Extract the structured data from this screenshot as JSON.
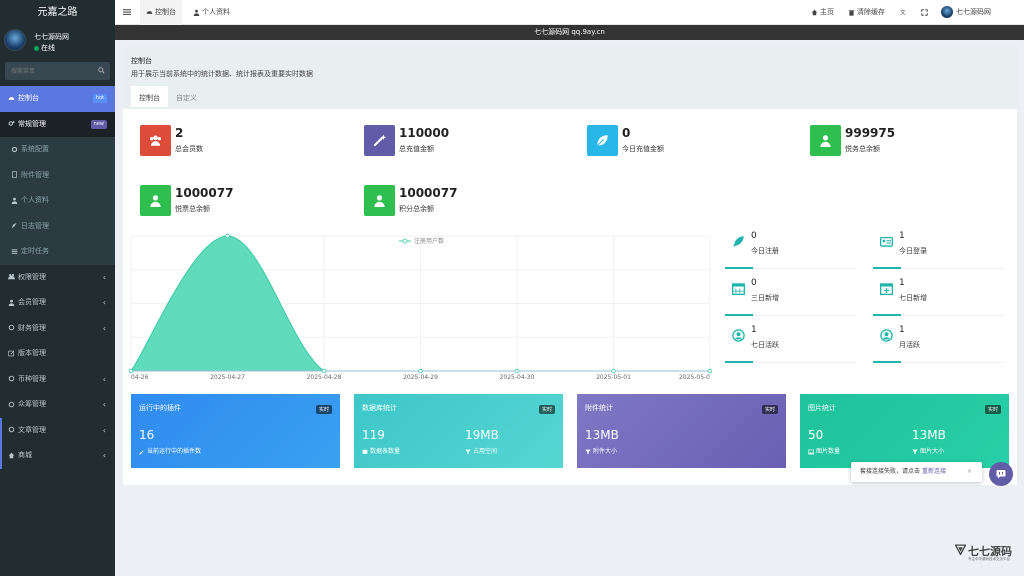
{
  "sidebar": {
    "logo": "元嘉之路",
    "user_name": "七七源码网",
    "user_status": "在线",
    "search_placeholder": "搜索菜单",
    "items": [
      {
        "label": "控制台",
        "icon": "dashboard-icon",
        "badge": "hot"
      },
      {
        "label": "常规管理",
        "icon": "cogs-icon",
        "badge": "new"
      },
      {
        "label": "系统配置",
        "icon": "gear-icon"
      },
      {
        "label": "附件管理",
        "icon": "file-icon"
      },
      {
        "label": "个人资料",
        "icon": "user-icon"
      },
      {
        "label": "日志管理",
        "icon": "pen-icon"
      },
      {
        "label": "定时任务",
        "icon": "list-icon"
      },
      {
        "label": "权限管理",
        "icon": "group-icon"
      },
      {
        "label": "会员管理",
        "icon": "user-icon"
      },
      {
        "label": "财务管理",
        "icon": "circle-icon"
      },
      {
        "label": "版本管理",
        "icon": "edit-icon"
      },
      {
        "label": "币种管理",
        "icon": "circle-icon"
      },
      {
        "label": "众筹管理",
        "icon": "circle-icon"
      },
      {
        "label": "文章管理",
        "icon": "circle-icon"
      },
      {
        "label": "商城",
        "icon": "home-icon"
      }
    ]
  },
  "topbar": {
    "tabs": [
      {
        "label": "控制台",
        "icon": "dashboard-icon"
      },
      {
        "label": "个人资料",
        "icon": "user-icon"
      }
    ],
    "home": "主页",
    "clear_cache": "清除缓存",
    "user": "七七源码网"
  },
  "banner": "七七源码网 qq.9ay.cn",
  "panel": {
    "title": "控制台",
    "desc": "用于展示当前系统中的统计数据、统计报表及重要实时数据",
    "tabs": [
      "控制台",
      "自定义"
    ]
  },
  "stats": [
    {
      "value": "2",
      "label": "总会员数",
      "color": "#dd4b39",
      "icon": "users-icon"
    },
    {
      "value": "110000",
      "label": "总充值金额",
      "color": "#605ca8",
      "icon": "magic-icon"
    },
    {
      "value": "0",
      "label": "今日充值金额",
      "color": "#29b6e8",
      "icon": "leaf-icon"
    },
    {
      "value": "999975",
      "label": "悦务总余额",
      "color": "#2fbf4f",
      "icon": "user-icon"
    },
    {
      "value": "1000077",
      "label": "悦票总余额",
      "color": "#2fbf4f",
      "icon": "user-icon"
    },
    {
      "value": "1000077",
      "label": "积分总余额",
      "color": "#2fbf4f",
      "icon": "user-icon"
    }
  ],
  "chart_data": {
    "type": "area",
    "legend": "注册用户数",
    "x": [
      "04-26",
      "2025-04-27",
      "2025-04-28",
      "2025-04-29",
      "2025-04-30",
      "2025-05-01",
      "2025-05-0"
    ],
    "series": [
      {
        "name": "注册用户数",
        "values": [
          0,
          1,
          0,
          0,
          0,
          0,
          0
        ]
      }
    ],
    "color": "#4fd8b5"
  },
  "mini_stats": [
    {
      "value": "0",
      "label": "今日注册",
      "icon": "rocket-icon"
    },
    {
      "value": "1",
      "label": "今日登录",
      "icon": "id-card-icon"
    },
    {
      "value": "0",
      "label": "三日新增",
      "icon": "calendar-icon"
    },
    {
      "value": "1",
      "label": "七日新增",
      "icon": "calendar-plus-icon"
    },
    {
      "value": "1",
      "label": "七日活跃",
      "icon": "user-circle-icon"
    },
    {
      "value": "1",
      "label": "月活跃",
      "icon": "user-circle-icon"
    }
  ],
  "cards": [
    {
      "title": "运行中的插件",
      "tag": "实时",
      "v1": "16",
      "s1": "当前运行中的插件数",
      "v2": "",
      "s2": ""
    },
    {
      "title": "数据库统计",
      "tag": "实时",
      "v1": "119",
      "s1": "数据表数量",
      "v2": "19MB",
      "s2": "占用空间"
    },
    {
      "title": "附件统计",
      "tag": "实时",
      "v1": "13MB",
      "s1": "附件大小",
      "v2": "",
      "s2": ""
    },
    {
      "title": "图片统计",
      "tag": "实时",
      "v1": "50",
      "s1": "图片数量",
      "v2": "13MB",
      "s2": "图片大小"
    }
  ],
  "toast": {
    "text": "套接连接失败，请点击",
    "link": "重新连接",
    "close": "×"
  },
  "watermark": {
    "title": "七七源码",
    "sub": "专注中华源码技术交流平台"
  }
}
